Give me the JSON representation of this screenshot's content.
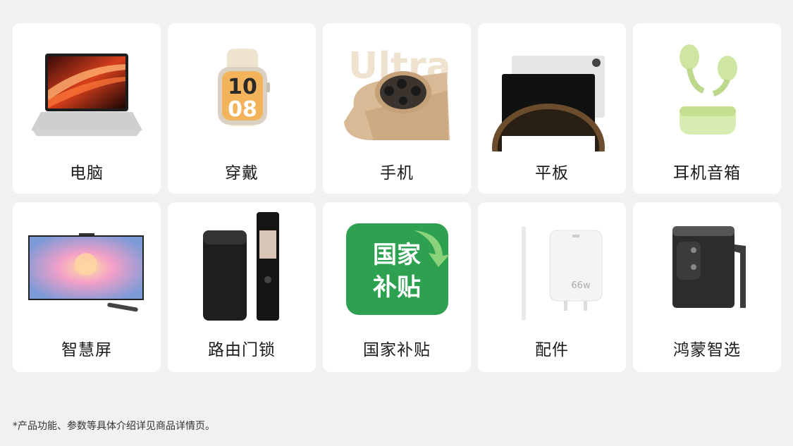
{
  "categories": [
    {
      "label": "电脑",
      "icon": "laptop-icon"
    },
    {
      "label": "穿戴",
      "icon": "smartwatch-icon"
    },
    {
      "label": "手机",
      "icon": "phone-icon"
    },
    {
      "label": "平板",
      "icon": "tablet-icon"
    },
    {
      "label": "耳机音箱",
      "icon": "earbuds-icon"
    },
    {
      "label": "智慧屏",
      "icon": "smart-screen-icon"
    },
    {
      "label": "路由门锁",
      "icon": "router-lock-icon"
    },
    {
      "label": "国家补贴",
      "icon": "national-subsidy-icon"
    },
    {
      "label": "配件",
      "icon": "charger-pen-icon"
    },
    {
      "label": "鸿蒙智选",
      "icon": "water-dispenser-icon"
    }
  ],
  "images": {
    "watch_hour": "10",
    "watch_minute": "08",
    "phone_banner": "Ultra",
    "subsidy_line1": "国家",
    "subsidy_line2": "补贴",
    "charger_wattage": "66w"
  },
  "footnote": "*产品功能、参数等具体介绍详见商品详情页。",
  "colors": {
    "background": "#f1f1f1",
    "card": "#ffffff",
    "subsidy_green": "#2ea151",
    "earbuds_green": "#d6ecb0"
  }
}
